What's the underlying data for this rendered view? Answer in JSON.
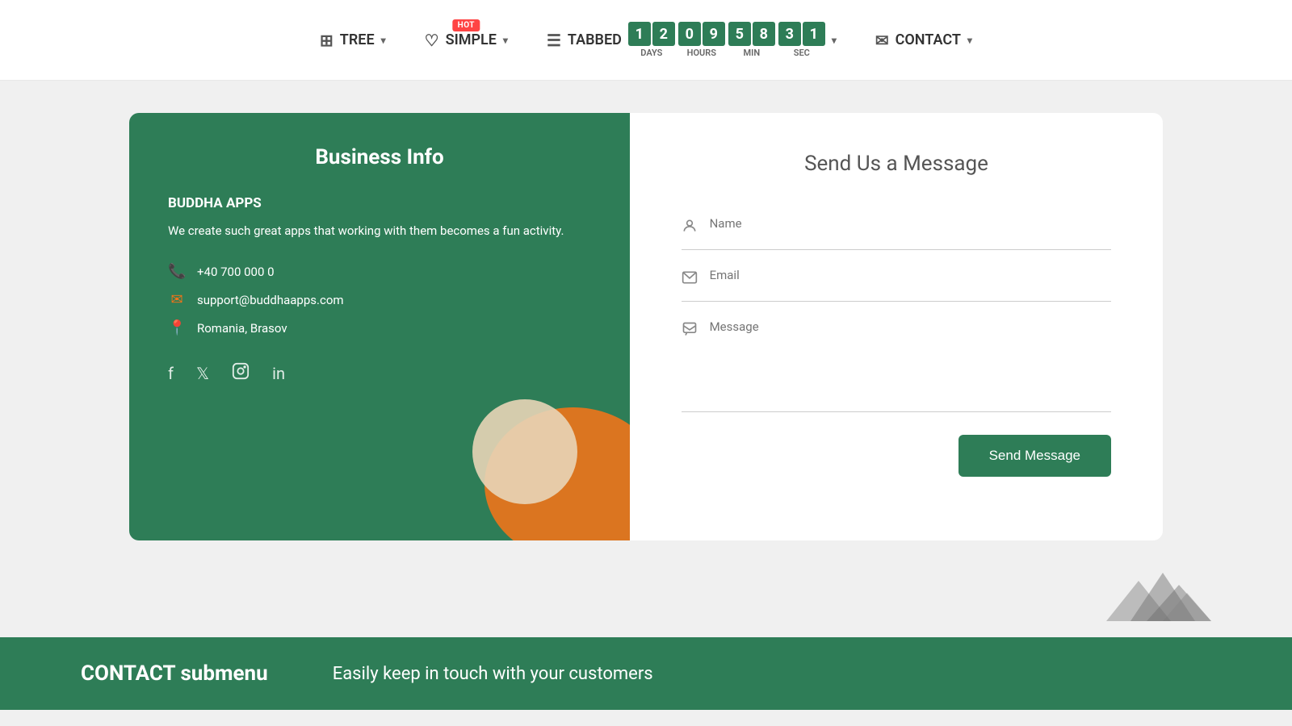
{
  "navbar": {
    "tree_label": "TREE",
    "simple_label": "SIMPLE",
    "hot_badge": "HOT",
    "tabbed_label": "TABBED",
    "contact_label": "CONTACT",
    "countdown": {
      "days": [
        "1",
        "2"
      ],
      "hours": [
        "0",
        "9"
      ],
      "min": [
        "5",
        "8"
      ],
      "sec": [
        "3",
        "1"
      ],
      "days_label": "DAYS",
      "hours_label": "HOURS",
      "min_label": "MIN",
      "sec_label": "SEC"
    }
  },
  "business_card": {
    "title": "Business Info",
    "company_name": "BUDDHA APPS",
    "description": "We create such great apps that working with them becomes a fun activity.",
    "phone": "+40 700 000 0",
    "email": "support@buddhaapps.com",
    "location": "Romania, Brasov"
  },
  "contact_form": {
    "title": "Send Us a Message",
    "name_placeholder": "Name",
    "email_placeholder": "Email",
    "message_placeholder": "Message",
    "send_button_label": "Send Message"
  },
  "footer": {
    "title": "CONTACT submenu",
    "subtitle": "Easily keep in touch with your customers"
  }
}
